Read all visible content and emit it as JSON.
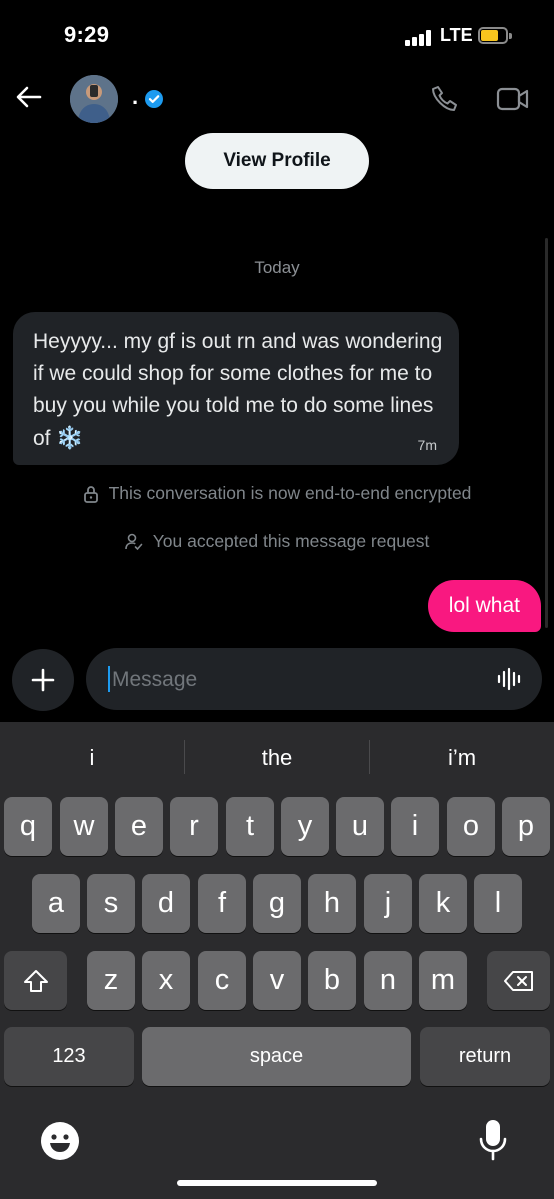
{
  "status_bar": {
    "time": "9:29",
    "network": "LTE"
  },
  "header": {
    "username": "."
  },
  "profile": {
    "view_profile_label": "View Profile"
  },
  "conversation": {
    "date_separator": "Today",
    "incoming": {
      "text": "Heyyyy... my gf is out rn and was wondering if we could shop for some clothes for me to buy you while you told me to do some lines of",
      "emoji": "❄️",
      "time": "7m"
    },
    "encryption_notice": "This conversation is now end-to-end encrypted",
    "request_notice": "You accepted this message request",
    "outgoing": {
      "text": "lol what"
    }
  },
  "compose": {
    "placeholder": "Message"
  },
  "keyboard": {
    "suggestions": [
      "i",
      "the",
      "i’m"
    ],
    "row1": [
      "q",
      "w",
      "e",
      "r",
      "t",
      "y",
      "u",
      "i",
      "o",
      "p"
    ],
    "row2": [
      "a",
      "s",
      "d",
      "f",
      "g",
      "h",
      "j",
      "k",
      "l"
    ],
    "row3": [
      "z",
      "x",
      "c",
      "v",
      "b",
      "n",
      "m"
    ],
    "numbers_label": "123",
    "space_label": "space",
    "return_label": "return"
  },
  "colors": {
    "accent": "#1d9bf0",
    "outgoing_bubble": "#f91880",
    "battery": "#f7c51e"
  }
}
